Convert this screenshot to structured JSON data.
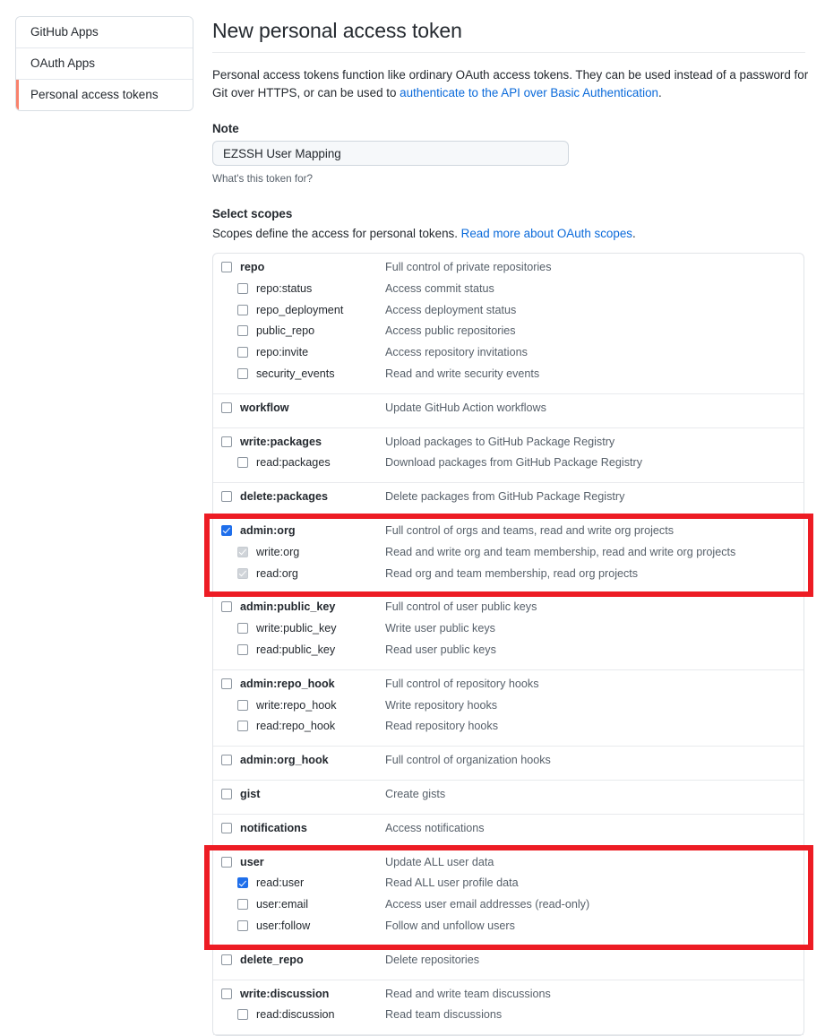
{
  "sidebar": {
    "items": [
      {
        "label": "GitHub Apps",
        "active": false
      },
      {
        "label": "OAuth Apps",
        "active": false
      },
      {
        "label": "Personal access tokens",
        "active": true
      }
    ],
    "active_indicator_color": "#f9826c"
  },
  "main": {
    "title": "New personal access token",
    "intro_part1": "Personal access tokens function like ordinary OAuth access tokens. They can be used instead of a password for Git over HTTPS, or can be used to ",
    "intro_link": "authenticate to the API over Basic Authentication",
    "intro_part2": ".",
    "note_label": "Note",
    "note_value": "EZSSH User Mapping",
    "note_placeholder": "What's this token for?",
    "note_hint": "What's this token for?",
    "scopes_title": "Select scopes",
    "scopes_sub_part1": "Scopes define the access for personal tokens. ",
    "scopes_sub_link": "Read more about OAuth scopes",
    "scopes_sub_part2": "."
  },
  "highlight": {
    "color": "#ed1c24",
    "boxes": [
      "admin:org",
      "user"
    ]
  },
  "scopes": [
    {
      "group": "repo",
      "rows": [
        {
          "name": "repo",
          "desc": "Full control of private repositories",
          "child": false,
          "state": "unchecked"
        },
        {
          "name": "repo:status",
          "desc": "Access commit status",
          "child": true,
          "state": "unchecked"
        },
        {
          "name": "repo_deployment",
          "desc": "Access deployment status",
          "child": true,
          "state": "unchecked"
        },
        {
          "name": "public_repo",
          "desc": "Access public repositories",
          "child": true,
          "state": "unchecked"
        },
        {
          "name": "repo:invite",
          "desc": "Access repository invitations",
          "child": true,
          "state": "unchecked"
        },
        {
          "name": "security_events",
          "desc": "Read and write security events",
          "child": true,
          "state": "unchecked"
        }
      ]
    },
    {
      "group": "workflow",
      "rows": [
        {
          "name": "workflow",
          "desc": "Update GitHub Action workflows",
          "child": false,
          "state": "unchecked"
        }
      ]
    },
    {
      "group": "write:packages",
      "rows": [
        {
          "name": "write:packages",
          "desc": "Upload packages to GitHub Package Registry",
          "child": false,
          "state": "unchecked"
        },
        {
          "name": "read:packages",
          "desc": "Download packages from GitHub Package Registry",
          "child": true,
          "state": "unchecked"
        }
      ]
    },
    {
      "group": "delete:packages",
      "rows": [
        {
          "name": "delete:packages",
          "desc": "Delete packages from GitHub Package Registry",
          "child": false,
          "state": "unchecked"
        }
      ]
    },
    {
      "group": "admin:org",
      "highlighted": true,
      "rows": [
        {
          "name": "admin:org",
          "desc": "Full control of orgs and teams, read and write org projects",
          "child": false,
          "state": "checked"
        },
        {
          "name": "write:org",
          "desc": "Read and write org and team membership, read and write org projects",
          "child": true,
          "state": "disabled-checked"
        },
        {
          "name": "read:org",
          "desc": "Read org and team membership, read org projects",
          "child": true,
          "state": "disabled-checked"
        }
      ]
    },
    {
      "group": "admin:public_key",
      "rows": [
        {
          "name": "admin:public_key",
          "desc": "Full control of user public keys",
          "child": false,
          "state": "unchecked"
        },
        {
          "name": "write:public_key",
          "desc": "Write user public keys",
          "child": true,
          "state": "unchecked"
        },
        {
          "name": "read:public_key",
          "desc": "Read user public keys",
          "child": true,
          "state": "unchecked"
        }
      ]
    },
    {
      "group": "admin:repo_hook",
      "rows": [
        {
          "name": "admin:repo_hook",
          "desc": "Full control of repository hooks",
          "child": false,
          "state": "unchecked"
        },
        {
          "name": "write:repo_hook",
          "desc": "Write repository hooks",
          "child": true,
          "state": "unchecked"
        },
        {
          "name": "read:repo_hook",
          "desc": "Read repository hooks",
          "child": true,
          "state": "unchecked"
        }
      ]
    },
    {
      "group": "admin:org_hook",
      "rows": [
        {
          "name": "admin:org_hook",
          "desc": "Full control of organization hooks",
          "child": false,
          "state": "unchecked"
        }
      ]
    },
    {
      "group": "gist",
      "rows": [
        {
          "name": "gist",
          "desc": "Create gists",
          "child": false,
          "state": "unchecked"
        }
      ]
    },
    {
      "group": "notifications",
      "rows": [
        {
          "name": "notifications",
          "desc": "Access notifications",
          "child": false,
          "state": "unchecked"
        }
      ]
    },
    {
      "group": "user",
      "highlighted": true,
      "rows": [
        {
          "name": "user",
          "desc": "Update ALL user data",
          "child": false,
          "state": "unchecked"
        },
        {
          "name": "read:user",
          "desc": "Read ALL user profile data",
          "child": true,
          "state": "checked"
        },
        {
          "name": "user:email",
          "desc": "Access user email addresses (read-only)",
          "child": true,
          "state": "unchecked"
        },
        {
          "name": "user:follow",
          "desc": "Follow and unfollow users",
          "child": true,
          "state": "unchecked"
        }
      ]
    },
    {
      "group": "delete_repo",
      "rows": [
        {
          "name": "delete_repo",
          "desc": "Delete repositories",
          "child": false,
          "state": "unchecked"
        }
      ]
    },
    {
      "group": "write:discussion",
      "rows": [
        {
          "name": "write:discussion",
          "desc": "Read and write team discussions",
          "child": false,
          "state": "unchecked"
        },
        {
          "name": "read:discussion",
          "desc": "Read team discussions",
          "child": true,
          "state": "unchecked"
        }
      ]
    }
  ]
}
